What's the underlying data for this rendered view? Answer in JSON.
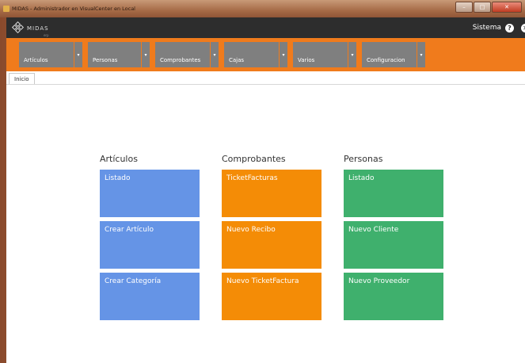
{
  "window": {
    "title": "MIDAS - Administrador en VisualCenter en Local",
    "minimize": "–",
    "maximize": "□",
    "close": "✕"
  },
  "appbar": {
    "logo_text": "MIDAS",
    "logo_sub": "erp",
    "sistema_label": "Sistema",
    "help_glyph": "?",
    "close_glyph": "✕"
  },
  "menu": {
    "items": [
      {
        "label": "Artículos",
        "icon": "chevron-down-icon"
      },
      {
        "label": "Personas",
        "icon": "chevron-down-icon"
      },
      {
        "label": "Comprobantes",
        "icon": "chevron-down-icon"
      },
      {
        "label": "Cajas",
        "icon": "chevron-down-icon"
      },
      {
        "label": "Varios",
        "icon": "chevron-down-icon"
      },
      {
        "label": "Configuracion",
        "icon": "chevron-down-icon"
      }
    ],
    "arrow_glyph": "▾"
  },
  "tabs": [
    {
      "label": "Inicio"
    }
  ],
  "groups": [
    {
      "title": "Artículos",
      "color": "#6594e6",
      "tiles": [
        {
          "label": "Listado"
        },
        {
          "label": "Crear Artículo"
        },
        {
          "label": "Crear Categoría"
        }
      ]
    },
    {
      "title": "Comprobantes",
      "color": "#f48c06",
      "tiles": [
        {
          "label": "TicketFacturas"
        },
        {
          "label": "Nuevo Recibo"
        },
        {
          "label": "Nuevo TicketFactura"
        }
      ]
    },
    {
      "title": "Personas",
      "color": "#3fb06d",
      "tiles": [
        {
          "label": "Listado"
        },
        {
          "label": "Nuevo Cliente"
        },
        {
          "label": "Nuevo Proveedor"
        }
      ]
    }
  ],
  "colors": {
    "menubar": "#f07b1c",
    "appbar": "#2d2d2d",
    "menu_item": "#7f7f7f"
  }
}
